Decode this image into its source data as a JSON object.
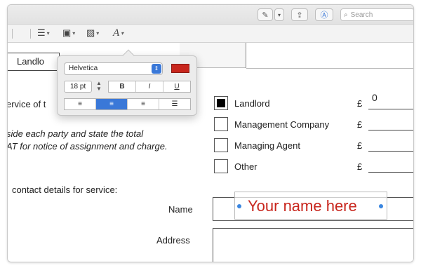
{
  "titlebar": {
    "search_placeholder": "Search",
    "search_icon": "magnifier-icon",
    "buttons": [
      "pen-icon",
      "chevron-down-icon",
      "share-icon",
      "markup-icon"
    ]
  },
  "markup_toolbar": {
    "items": [
      "lines-style-icon",
      "border-icon",
      "fill-color-icon",
      "text-style-icon"
    ],
    "text_style_glyph": "A"
  },
  "font_popover": {
    "font_family": "Helvetica",
    "font_size": "18 pt",
    "color": "#c8261d",
    "bold": "B",
    "italic": "I",
    "underline": "U",
    "alignments": [
      "align-left",
      "align-center",
      "align-right",
      "justify"
    ],
    "active_alignment": "align-center"
  },
  "document": {
    "landlord_tab_label": "Landlo",
    "service_text": "ervice of t",
    "instruction_line1": "side each party and state the total",
    "instruction_line2": "AT for notice of assignment and charge.",
    "contact_text": "contact details for service:",
    "name_label": "Name",
    "address_label": "Address",
    "options": [
      {
        "label": "Landlord",
        "checked": true,
        "currency": "£",
        "amount": "0"
      },
      {
        "label": "Management Company",
        "checked": false,
        "currency": "£",
        "amount": ""
      },
      {
        "label": "Managing Agent",
        "checked": false,
        "currency": "£",
        "amount": ""
      },
      {
        "label": "Other",
        "checked": false,
        "currency": "£",
        "amount": ""
      }
    ],
    "name_annotation": "Your name here",
    "annotation_color": "#c8261d"
  }
}
